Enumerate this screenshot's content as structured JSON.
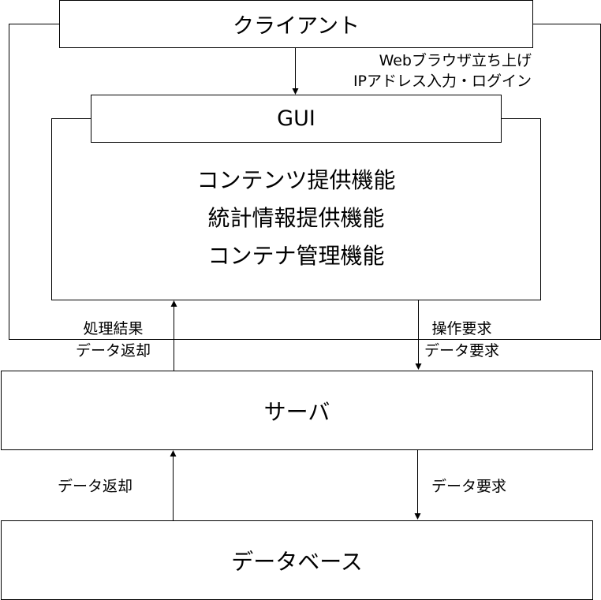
{
  "client": {
    "title": "クライアント"
  },
  "gui": {
    "title": "GUI",
    "functions": [
      "コンテンツ提供機能",
      "統計情報提供機能",
      "コンテナ管理機能"
    ]
  },
  "server": {
    "title": "サーバ"
  },
  "database": {
    "title": "データベース"
  },
  "edges": {
    "client_to_gui": [
      "Webブラウザ立ち上げ",
      "IPアドレス入力・ログイン"
    ],
    "server_to_gui": [
      "処理結果",
      "データ返却"
    ],
    "gui_to_server": [
      "操作要求",
      "データ要求"
    ],
    "db_to_server": [
      "データ返却"
    ],
    "server_to_db": [
      "データ要求"
    ]
  }
}
